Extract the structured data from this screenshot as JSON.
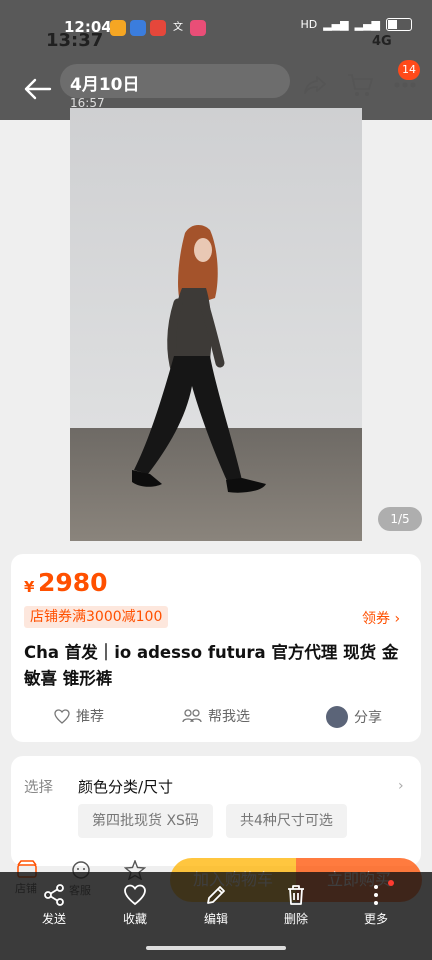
{
  "status": {
    "time": "12:04",
    "ghost_time": "13:37",
    "network_4g": "4G",
    "icons": [
      "app-icon-1",
      "app-icon-2",
      "app-icon-3",
      "app-icon-4",
      "app-icon-5"
    ]
  },
  "viewer": {
    "date": "4月10日",
    "time": "16:57",
    "badge_count": "14",
    "indicator": "1/5",
    "actions": [
      {
        "icon": "share-icon",
        "label": "发送"
      },
      {
        "icon": "heart-icon",
        "label": "收藏"
      },
      {
        "icon": "pencil-icon",
        "label": "编辑"
      },
      {
        "icon": "trash-icon",
        "label": "删除"
      },
      {
        "icon": "more-icon",
        "label": "更多"
      }
    ]
  },
  "product": {
    "currency": "¥",
    "price": "2980",
    "coupon": "店铺券满3000减100",
    "coupon_link": "领券 ›",
    "title": "Cha 首发｜io adesso futura 官方代理 现货 金敏喜 锥形裤",
    "actions": {
      "recommend": "推荐",
      "help_choose": "帮我选",
      "share": "分享"
    },
    "selection_label": "选择",
    "selection_value": "颜色分类/尺寸",
    "chips": [
      "第四批现货 XS码",
      "共4种尺寸可选"
    ]
  },
  "cart_bar": {
    "store": "店铺",
    "service": "客服",
    "favorite": "",
    "add_to_cart": "加入购物车",
    "buy_now": "立即购买"
  },
  "colors": {
    "accent": "#ff5000",
    "yellow": "#ffb300"
  }
}
